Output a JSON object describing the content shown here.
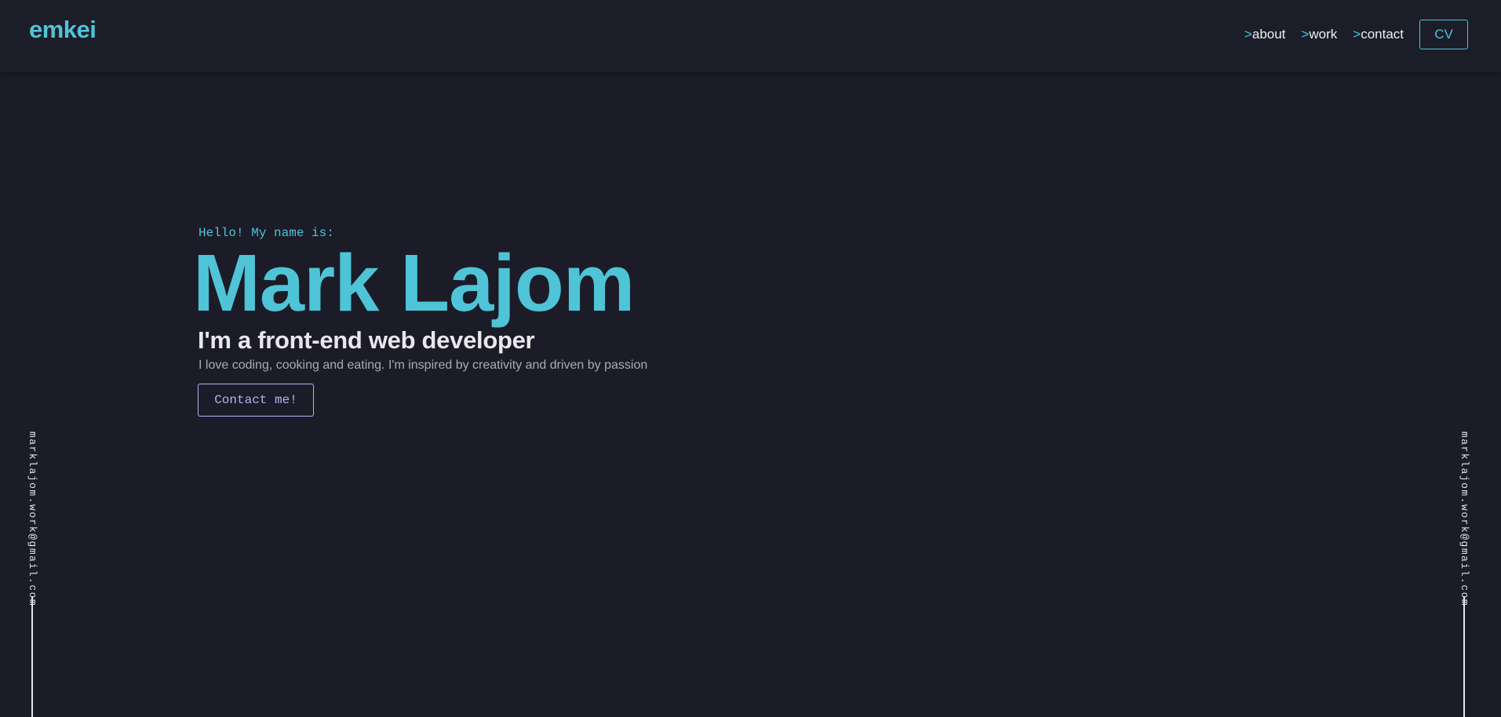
{
  "header": {
    "logo": "emkei",
    "nav": [
      {
        "prefix": ">",
        "label": "about"
      },
      {
        "prefix": ">",
        "label": "work"
      },
      {
        "prefix": ">",
        "label": "contact"
      }
    ],
    "cv_label": "CV"
  },
  "hero": {
    "greeting": "Hello! My name is:",
    "name": "Mark Lajom",
    "role": "I'm a front-end web developer",
    "description": "I love coding, cooking and eating. I'm inspired by creativity and driven by passion",
    "contact_label": "Contact me!"
  },
  "side": {
    "left_email": "marklajom.work@gmail.com",
    "right_email": "marklajom.work@gmail.com"
  },
  "colors": {
    "background": "#1b1c28",
    "accent": "#4fc4d6",
    "button_purple": "#b8b0f5",
    "text_light": "#e8e8ec",
    "text_muted": "#a9abb5"
  }
}
